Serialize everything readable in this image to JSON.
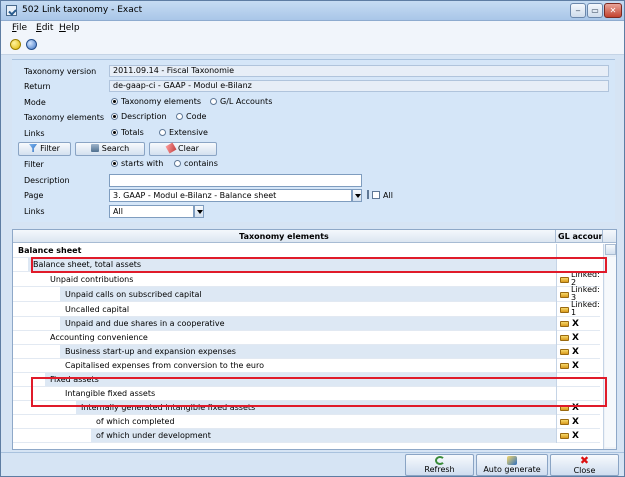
{
  "window": {
    "title": "502 Link taxonomy - Exact",
    "buttons": {
      "minimize": "‒",
      "maximize": "▭",
      "close": "✕"
    }
  },
  "menu": [
    {
      "label": "File",
      "ul": "F",
      "rest": "ile"
    },
    {
      "label": "Edit",
      "ul": "E",
      "rest": "dit"
    },
    {
      "label": "Help",
      "ul": "H",
      "rest": "elp"
    }
  ],
  "form": {
    "taxonomy_version": {
      "label": "Taxonomy version",
      "value": "2011.09.14 - Fiscal Taxonomie"
    },
    "return": {
      "label": "Return",
      "value": "de-gaap-ci - GAAP - Modul e-Bilanz"
    },
    "mode": {
      "label": "Mode",
      "options": [
        "Taxonomy elements",
        "G/L Accounts"
      ],
      "selected": "Taxonomy elements"
    },
    "taxonomy_elements": {
      "label": "Taxonomy elements",
      "options": [
        "Description",
        "Code"
      ],
      "selected": "Description"
    },
    "links": {
      "label": "Links",
      "options": [
        "Totals",
        "Extensive"
      ],
      "selected": "Totals"
    },
    "buttons": {
      "filter": "Filter",
      "search": "Search",
      "clear": "Clear"
    },
    "filter": {
      "label": "Filter",
      "options": [
        "starts with",
        "contains"
      ],
      "selected": "starts with"
    },
    "description": {
      "label": "Description",
      "value": ""
    },
    "page": {
      "label": "Page",
      "value": "3.  GAAP - Modul e-Bilanz - Balance sheet",
      "all_label": "All",
      "all_checked": false
    },
    "links_filter": {
      "label": "Links",
      "value": "All"
    }
  },
  "grid": {
    "columns": [
      "Taxonomy elements",
      "GL account"
    ],
    "rows": [
      {
        "text": "Balance sheet",
        "level": 0,
        "bold": true,
        "gl": ""
      },
      {
        "text": "Balance sheet, total assets",
        "level": 1,
        "gl": ""
      },
      {
        "text": "Unpaid contributions",
        "level": 2,
        "gl": "Linked: 2"
      },
      {
        "text": "Unpaid calls on subscribed capital",
        "level": 3,
        "gl": "Linked: 3"
      },
      {
        "text": "Uncalled capital",
        "level": 3,
        "gl": "Linked: 1"
      },
      {
        "text": "Unpaid and due shares in a cooperative",
        "level": 3,
        "gl": "X"
      },
      {
        "text": "Accounting convenience",
        "level": 2,
        "gl": "X"
      },
      {
        "text": "Business start-up and expansion expenses",
        "level": 3,
        "gl": "X"
      },
      {
        "text": "Capitalised expenses from conversion to the euro",
        "level": 3,
        "gl": "X"
      },
      {
        "text": "Fixed assets",
        "level": 2,
        "gl": ""
      },
      {
        "text": "Intangible fixed assets",
        "level": 3,
        "gl": ""
      },
      {
        "text": "Internally generated intangible fixed assets",
        "level": 4,
        "gl": "X"
      },
      {
        "text": "of which completed",
        "level": 5,
        "gl": "X"
      },
      {
        "text": "of which under development",
        "level": 5,
        "gl": "X"
      }
    ]
  },
  "footer": {
    "refresh": "Refresh",
    "auto_generate": "Auto generate",
    "close": "Close"
  }
}
